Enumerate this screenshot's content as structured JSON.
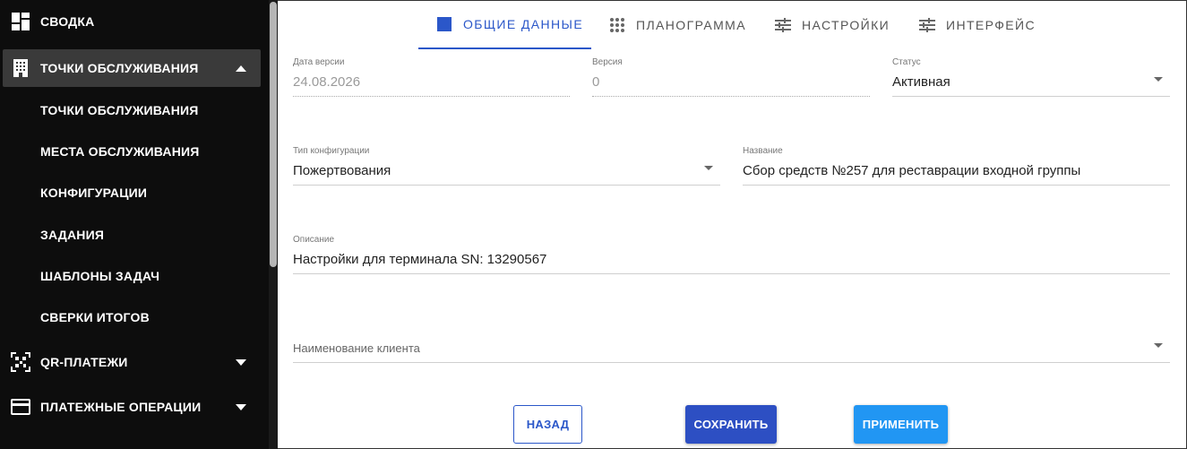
{
  "sidebar": {
    "items": [
      {
        "label": "СВОДКА",
        "icon": "dashboard-icon"
      },
      {
        "label": "ТОЧКИ ОБСЛУЖИВАНИЯ",
        "icon": "building-icon",
        "expanded": true
      },
      {
        "label": "QR-ПЛАТЕЖИ",
        "icon": "qr-code-icon"
      },
      {
        "label": "ПЛАТЕЖНЫЕ ОПЕРАЦИИ",
        "icon": "credit-card-icon"
      }
    ],
    "subitems": [
      "ТОЧКИ ОБСЛУЖИВАНИЯ",
      "МЕСТА ОБСЛУЖИВАНИЯ",
      "КОНФИГУРАЦИИ",
      "ЗАДАНИЯ",
      "ШАБЛОНЫ ЗАДАЧ",
      "СВЕРКИ ИТОГОВ"
    ]
  },
  "tabs": [
    {
      "label": "ОБЩИЕ ДАННЫЕ",
      "icon": "square-icon",
      "active": true
    },
    {
      "label": "ПЛАНОГРАММА",
      "icon": "grid-dots-icon"
    },
    {
      "label": "НАСТРОЙКИ",
      "icon": "sliders-icon"
    },
    {
      "label": "ИНТЕРФЕЙС",
      "icon": "sliders-icon"
    }
  ],
  "form": {
    "version_date": {
      "label": "Дата версии",
      "value": "24.08.2026"
    },
    "version": {
      "label": "Версия",
      "value": "0"
    },
    "status": {
      "label": "Статус",
      "value": "Активная"
    },
    "config_type": {
      "label": "Тип конфигурации",
      "value": "Пожертвования"
    },
    "name": {
      "label": "Название",
      "value": "Сбор средств №257 для реставрации входной группы"
    },
    "description": {
      "label": "Описание",
      "value": "Настройки для терминала SN: 13290567"
    },
    "client": {
      "placeholder": "Наименование клиента"
    }
  },
  "buttons": {
    "back": "НАЗАД",
    "save": "СОХРАНИТЬ",
    "apply": "ПРИМЕНИТЬ"
  },
  "colors": {
    "accent": "#2b57c9",
    "apply": "#2196f3",
    "sidebar_bg": "#0d0d0d"
  }
}
